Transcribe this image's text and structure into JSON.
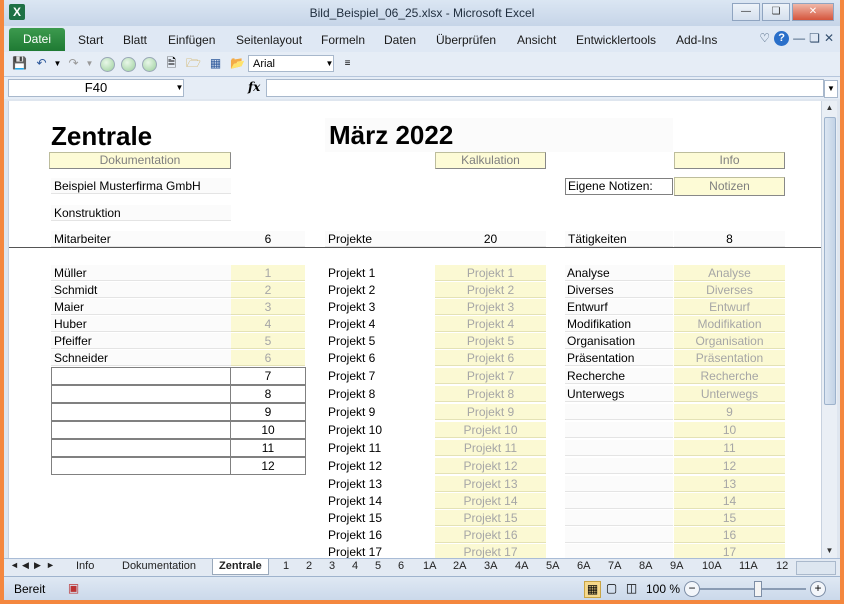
{
  "window": {
    "title": "Bild_Beispiel_06_25.xlsx  -  Microsoft Excel",
    "app_icon": "X"
  },
  "ribbon_tabs": [
    "Datei",
    "Start",
    "Blatt",
    "Einfügen",
    "Seitenlayout",
    "Formeln",
    "Daten",
    "Überprüfen",
    "Ansicht",
    "Entwicklertools",
    "Add-Ins"
  ],
  "toolbar": {
    "font": "Arial"
  },
  "formula_bar": {
    "name_box": "F40",
    "fx": "fx",
    "formula": ""
  },
  "sheet": {
    "title": "Zentrale",
    "date": "März 2022",
    "buttons": {
      "dokumentation": "Dokumentation",
      "kalkulation": "Kalkulation",
      "info": "Info",
      "notizen": "Notizen"
    },
    "company": "Beispiel Musterfirma GmbH",
    "department": "Konstruktion",
    "own_notes_label": "Eigene Notizen:",
    "summary": {
      "mitarbeiter_label": "Mitarbeiter",
      "mitarbeiter_count": "6",
      "projekte_label": "Projekte",
      "projekte_count": "20",
      "taetigkeiten_label": "Tätigkeiten",
      "taetigkeiten_count": "8"
    },
    "employees": [
      {
        "name": "Müller",
        "num": "1"
      },
      {
        "name": "Schmidt",
        "num": "2"
      },
      {
        "name": "Maier",
        "num": "3"
      },
      {
        "name": "Huber",
        "num": "4"
      },
      {
        "name": "Pfeiffer",
        "num": "5"
      },
      {
        "name": "Schneider",
        "num": "6"
      }
    ],
    "empty_employee_nums": [
      "7",
      "8",
      "9",
      "10",
      "11",
      "12"
    ],
    "projects": [
      {
        "name": "Projekt 1",
        "value": "Projekt 1"
      },
      {
        "name": "Projekt 2",
        "value": "Projekt 2"
      },
      {
        "name": "Projekt 3",
        "value": "Projekt 3"
      },
      {
        "name": "Projekt 4",
        "value": "Projekt 4"
      },
      {
        "name": "Projekt 5",
        "value": "Projekt 5"
      },
      {
        "name": "Projekt 6",
        "value": "Projekt 6"
      },
      {
        "name": "Projekt 7",
        "value": "Projekt 7"
      },
      {
        "name": "Projekt 8",
        "value": "Projekt 8"
      },
      {
        "name": "Projekt 9",
        "value": "Projekt 9"
      },
      {
        "name": "Projekt 10",
        "value": "Projekt 10"
      },
      {
        "name": "Projekt 11",
        "value": "Projekt 11"
      },
      {
        "name": "Projekt 12",
        "value": "Projekt 12"
      },
      {
        "name": "Projekt 13",
        "value": "Projekt 13"
      },
      {
        "name": "Projekt 14",
        "value": "Projekt 14"
      },
      {
        "name": "Projekt 15",
        "value": "Projekt 15"
      },
      {
        "name": "Projekt 16",
        "value": "Projekt 16"
      },
      {
        "name": "Projekt 17",
        "value": "Projekt 17"
      }
    ],
    "activities": [
      {
        "name": "Analyse",
        "value": "Analyse"
      },
      {
        "name": "Diverses",
        "value": "Diverses"
      },
      {
        "name": "Entwurf",
        "value": "Entwurf"
      },
      {
        "name": "Modifikation",
        "value": "Modifikation"
      },
      {
        "name": "Organisation",
        "value": "Organisation"
      },
      {
        "name": "Präsentation",
        "value": "Präsentation"
      },
      {
        "name": "Recherche",
        "value": "Recherche"
      },
      {
        "name": "Unterwegs",
        "value": "Unterwegs"
      }
    ],
    "activity_extra_nums": [
      "9",
      "10",
      "11",
      "12",
      "13",
      "14",
      "15",
      "16",
      "17"
    ]
  },
  "sheet_tabs": [
    "Info",
    "Dokumentation",
    "Zentrale",
    "1",
    "2",
    "3",
    "4",
    "5",
    "6",
    "1A",
    "2A",
    "3A",
    "4A",
    "5A",
    "6A",
    "7A",
    "8A",
    "9A",
    "10A",
    "11A",
    "12"
  ],
  "active_sheet": "Zentrale",
  "status": {
    "ready": "Bereit",
    "zoom": "100 %"
  }
}
